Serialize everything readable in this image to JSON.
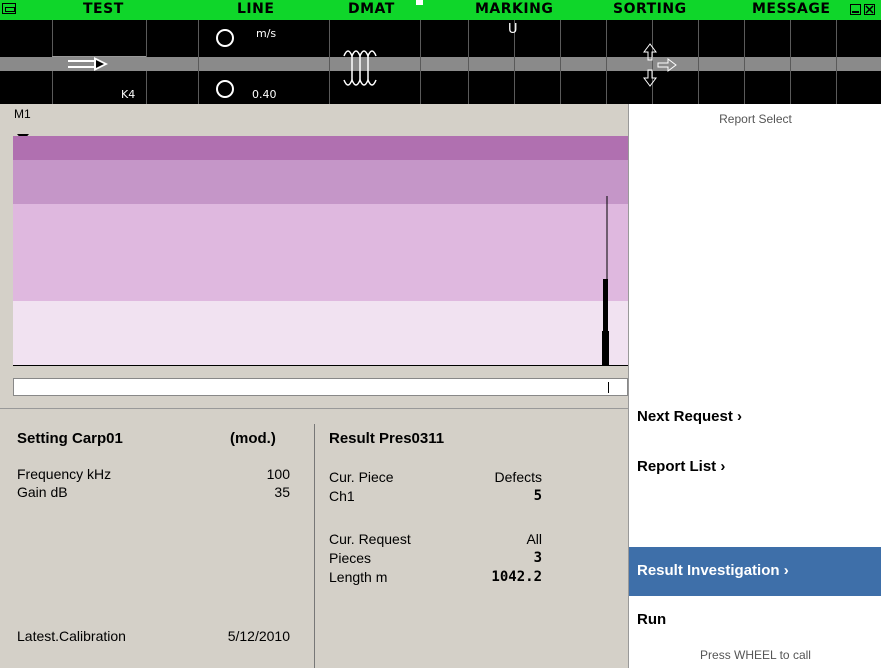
{
  "topbar": {
    "labels": {
      "test": "TEST",
      "line": "LINE",
      "dmat": "DMAT",
      "marking": "MARKING",
      "sorting": "SORTING",
      "message": "MESSAGE"
    },
    "speed_unit": "m/s",
    "speed_value": "0.40",
    "marking_value": "U",
    "sensor_label": "K4"
  },
  "m1": {
    "label": "M1"
  },
  "setting": {
    "title": "Setting Carp01",
    "mod": "(mod.)",
    "frequency_label": "Frequency kHz",
    "frequency_value": "100",
    "gain_label": "Gain dB",
    "gain_value": "35",
    "calibration_label": "Latest.Calibration",
    "calibration_value": "5/12/2010"
  },
  "result": {
    "title": "Result Pres0311",
    "cur_piece_label": "Cur. Piece",
    "defects_label": "Defects",
    "ch1_label": "Ch1",
    "ch1_value": "5",
    "cur_request_label": "Cur. Request",
    "cur_request_value": "All",
    "pieces_label": "Pieces",
    "pieces_value": "3",
    "length_label": "Length m",
    "length_value": "1042.2"
  },
  "right": {
    "report_select": "Report Select",
    "next_request": "Next Request ›",
    "report_list": "Report List ›",
    "result_investigation": "Result Investigation ›",
    "run": "Run",
    "press_wheel": "Press WHEEL to call"
  },
  "colors": {
    "topbar_green": "#0fd62a",
    "selected_blue": "#3e6fa9",
    "band_1": "#b070b0",
    "band_2": "#c596c8",
    "band_3": "#dfb8df",
    "band_4": "#f1e2f1"
  }
}
